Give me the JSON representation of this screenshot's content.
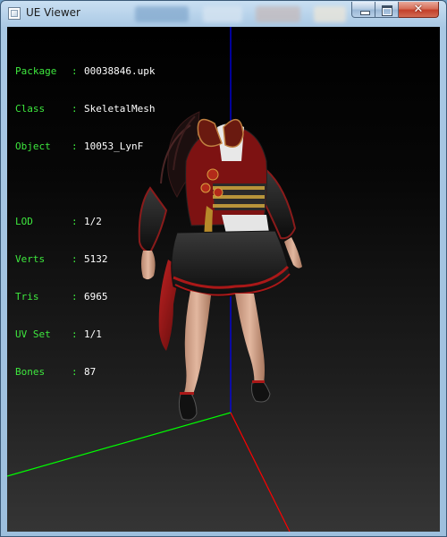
{
  "window": {
    "title": "UE Viewer",
    "minimize_glyph": "minimize-icon",
    "maximize_glyph": "maximize-icon",
    "close_glyph": "✕"
  },
  "info_overlay": {
    "key_color": "#3ee83e",
    "value_color": "#ffffff",
    "header": [
      {
        "key": "Package",
        "sep": ":",
        "value": "00038846.upk"
      },
      {
        "key": "Class",
        "sep": ":",
        "value": "SkeletalMesh"
      },
      {
        "key": "Object",
        "sep": ":",
        "value": "10053_LynF"
      }
    ],
    "stats": [
      {
        "key": "LOD",
        "sep": ":",
        "value": "1/2"
      },
      {
        "key": "Verts",
        "sep": ":",
        "value": "5132"
      },
      {
        "key": "Tris",
        "sep": ":",
        "value": "6965"
      },
      {
        "key": "UV Set",
        "sep": ":",
        "value": "1/1"
      },
      {
        "key": "Bones",
        "sep": ":",
        "value": "87"
      }
    ]
  },
  "axes": {
    "x_color": "#ff0000",
    "y_color": "#00ff00",
    "z_color": "#0000ff"
  }
}
